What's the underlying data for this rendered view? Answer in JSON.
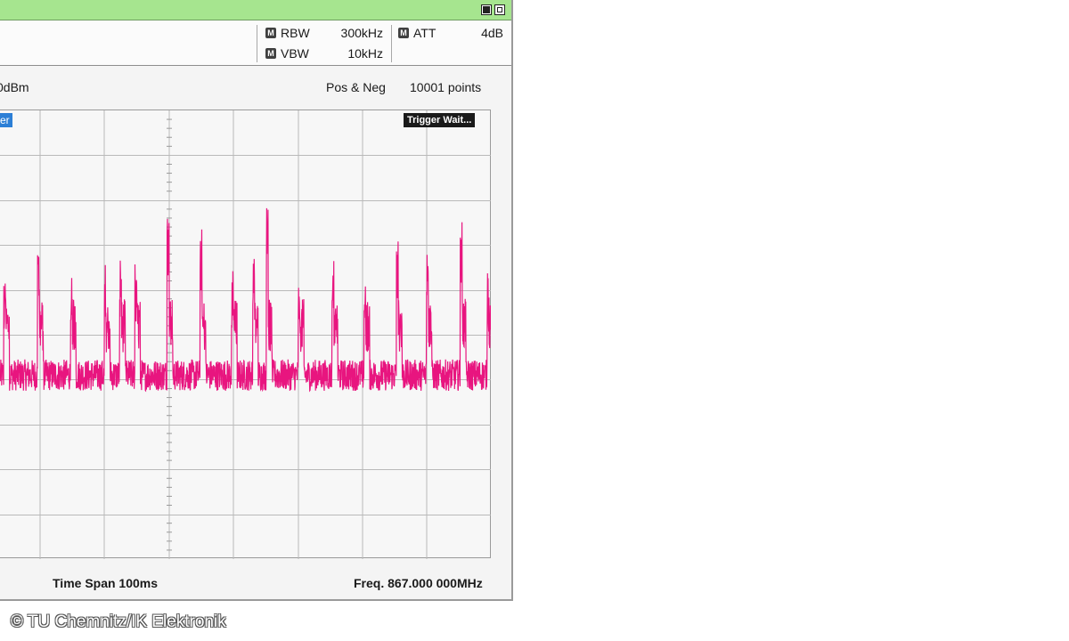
{
  "parameters": {
    "rbw": {
      "badge": "M",
      "label": "RBW",
      "value": "300kHz"
    },
    "vbw": {
      "badge": "M",
      "label": "VBW",
      "value": "10kHz"
    },
    "att": {
      "badge": "M",
      "label": "ATT",
      "value": "4dB"
    }
  },
  "info": {
    "ref_level": "0dBm",
    "detector": "Pos & Neg",
    "points": "10001 points"
  },
  "plot": {
    "marker_tag": "er",
    "trigger_status": "Trigger Wait...",
    "trace_color": "#e8157f",
    "grid_color": "#b9b9b9"
  },
  "footer": {
    "time_span": "Time Span 100ms",
    "frequency": "Freq. 867.000 000MHz"
  },
  "credit": "© TU Chemnitz/IK Elektronik",
  "chart_data": {
    "type": "line",
    "x_unit": "ms",
    "x_range": [
      0,
      100
    ],
    "series": [
      {
        "color": "#e8157f",
        "pulses": [
          {
            "t": 1,
            "peak": 0.64
          },
          {
            "t": 7.9,
            "peak": 0.71
          },
          {
            "t": 14.6,
            "peak": 0.68
          },
          {
            "t": 21.5,
            "peak": 0.66
          },
          {
            "t": 24.6,
            "peak": 0.69
          },
          {
            "t": 27.7,
            "peak": 0.67
          },
          {
            "t": 34.3,
            "peak": 0.76
          },
          {
            "t": 41.0,
            "peak": 0.74
          },
          {
            "t": 47.4,
            "peak": 0.66
          },
          {
            "t": 51.7,
            "peak": 0.67
          },
          {
            "t": 54.5,
            "peak": 0.81
          },
          {
            "t": 61.0,
            "peak": 0.67
          },
          {
            "t": 67.9,
            "peak": 0.69
          },
          {
            "t": 74.4,
            "peak": 0.66
          },
          {
            "t": 81.0,
            "peak": 0.72
          },
          {
            "t": 87.1,
            "peak": 0.68
          },
          {
            "t": 94.0,
            "peak": 0.76
          },
          {
            "t": 99.5,
            "peak": 0.65
          }
        ],
        "noise_floor": 0.41
      }
    ]
  }
}
